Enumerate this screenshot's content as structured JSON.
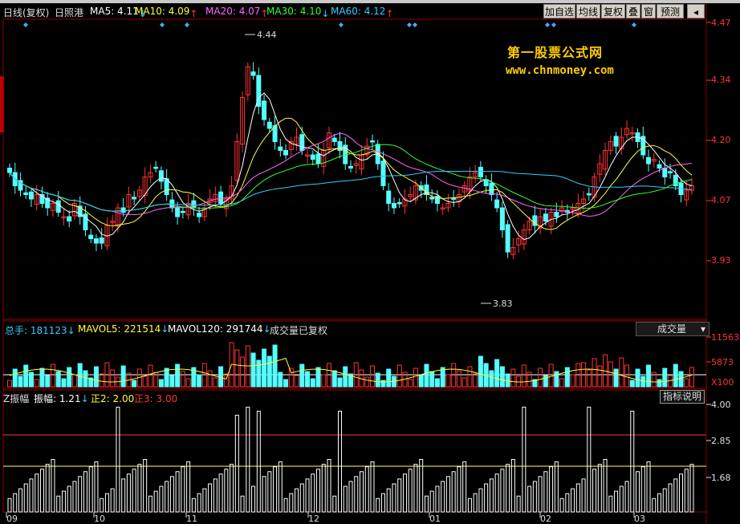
{
  "header": {
    "period": "日线(复权)",
    "stock": "日照港",
    "ma": [
      {
        "label": "MA5: 4.11",
        "arrow": "↓",
        "color": "#ffffff",
        "arrow_color": "#33ccff"
      },
      {
        "label": "MA10: 4.09",
        "arrow": "↑",
        "color": "#ffff33",
        "arrow_color": "#ff3333"
      },
      {
        "label": "MA20: 4.07",
        "arrow": "↑",
        "color": "#ff66ff",
        "arrow_color": "#ff3333"
      },
      {
        "label": "MA30: 4.10",
        "arrow": "↓",
        "color": "#33ff33",
        "arrow_color": "#33ccff"
      },
      {
        "label": "MA60: 4.12",
        "arrow": "↑",
        "color": "#33ccff",
        "arrow_color": "#ff3333"
      }
    ]
  },
  "toolbar": {
    "buttons": [
      "加自选",
      "均线",
      "复权",
      "叠",
      "窗",
      "预测"
    ],
    "nav_icon": "left-arrow-icon"
  },
  "watermark": {
    "line1": "第一股票公式网",
    "line2": "www.chnmoney.com"
  },
  "price_axis": {
    "ticks": [
      "4.47",
      "4.34",
      "4.20",
      "4.07",
      "3.93"
    ],
    "high_marker": "4.44",
    "low_marker": "3.83"
  },
  "volume_panel": {
    "total_label": "总手: 181123",
    "total_arrow": "↓",
    "mavol5_label": "MAVOL5: 221514",
    "mavol5_arrow": "↓",
    "mavol120_label": "MAVOL120: 291744",
    "mavol120_arrow": "↓",
    "note": "成交量已复权",
    "selector": "成交量",
    "ticks": [
      "11563",
      "5873",
      "X100"
    ]
  },
  "indicator_panel": {
    "name": "Z振幅",
    "amp_label": "振幅: 1.21",
    "amp_arrow": "↓",
    "z2_label": "正2: 2.00",
    "z3_label": "正3: 3.00",
    "button": "指标说明",
    "ticks": [
      "4.00",
      "2.85",
      "1.68"
    ]
  },
  "date_axis": [
    "09",
    "10",
    "11",
    "12",
    "01",
    "02",
    "03"
  ],
  "colors": {
    "up": "#ff3232",
    "down": "#54ffff",
    "grid": "#8b0000",
    "axis_text_red": "#ff3333",
    "axis_text": "#dddddd"
  }
}
